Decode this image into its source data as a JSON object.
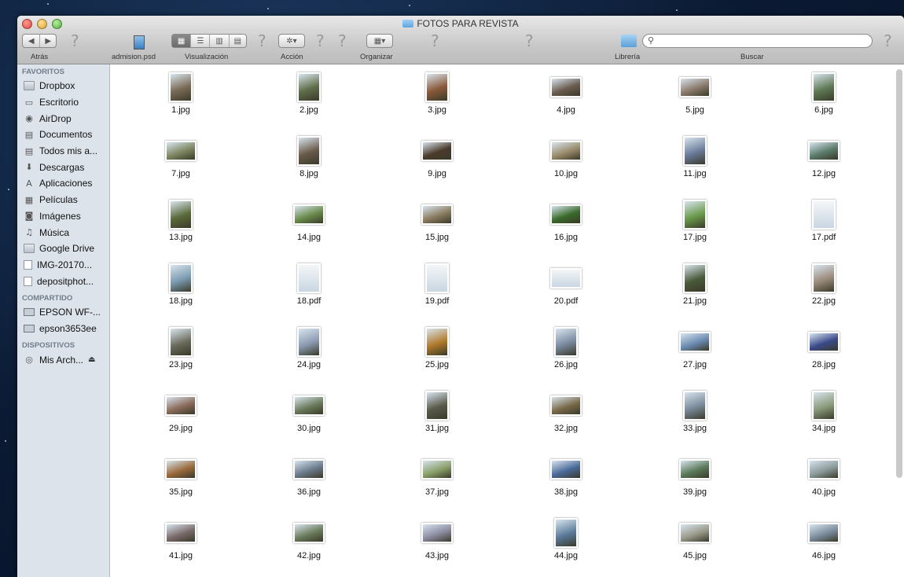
{
  "window": {
    "title": "FOTOS PARA REVISTA"
  },
  "toolbar": {
    "back_label": "Atrás",
    "file_label": "admision.psd",
    "view_label": "Visualización",
    "action_label": "Acción",
    "arrange_label": "Organizar",
    "library_label": "Librería",
    "search_label": "Buscar",
    "search_placeholder": ""
  },
  "sidebar": {
    "favorites_header": "FAVORITOS",
    "favorites": [
      {
        "label": "Dropbox",
        "icon": "folder-icon"
      },
      {
        "label": "Escritorio",
        "icon": "desktop-icon"
      },
      {
        "label": "AirDrop",
        "icon": "airdrop-icon"
      },
      {
        "label": "Documentos",
        "icon": "documents-icon"
      },
      {
        "label": "Todos mis a...",
        "icon": "all-files-icon"
      },
      {
        "label": "Descargas",
        "icon": "downloads-icon"
      },
      {
        "label": "Aplicaciones",
        "icon": "applications-icon"
      },
      {
        "label": "Películas",
        "icon": "movies-icon"
      },
      {
        "label": "Imágenes",
        "icon": "pictures-icon"
      },
      {
        "label": "Música",
        "icon": "music-icon"
      },
      {
        "label": "Google Drive",
        "icon": "folder-icon"
      },
      {
        "label": "IMG-20170...",
        "icon": "document-icon"
      },
      {
        "label": "depositphot...",
        "icon": "document-icon"
      }
    ],
    "shared_header": "COMPARTIDO",
    "shared": [
      {
        "label": "EPSON WF-...",
        "icon": "monitor-icon"
      },
      {
        "label": "epson3653ee",
        "icon": "monitor-icon"
      }
    ],
    "devices_header": "DISPOSITIVOS",
    "devices": [
      {
        "label": "Mis Arch...",
        "icon": "disc-icon"
      }
    ]
  },
  "files": [
    "1.jpg",
    "2.jpg",
    "3.jpg",
    "4.jpg",
    "5.jpg",
    "6.jpg",
    "7.jpg",
    "8.jpg",
    "9.jpg",
    "10.jpg",
    "11.jpg",
    "12.jpg",
    "13.jpg",
    "14.jpg",
    "15.jpg",
    "16.jpg",
    "17.jpg",
    "17.pdf",
    "18.jpg",
    "18.pdf",
    "19.pdf",
    "20.pdf",
    "21.jpg",
    "22.jpg",
    "23.jpg",
    "24.jpg",
    "25.jpg",
    "26.jpg",
    "27.jpg",
    "28.jpg",
    "29.jpg",
    "30.jpg",
    "31.jpg",
    "32.jpg",
    "33.jpg",
    "34.jpg",
    "35.jpg",
    "36.jpg",
    "37.jpg",
    "38.jpg",
    "39.jpg",
    "40.jpg",
    "41.jpg",
    "42.jpg",
    "43.jpg",
    "44.jpg",
    "45.jpg",
    "46.jpg"
  ],
  "thumb_colors": [
    "#7a6a55",
    "#5f6e4a",
    "#8b5a3a",
    "#6b5d4f",
    "#8a7a6a",
    "#5f7a55",
    "#7d8560",
    "#6a5a4a",
    "#4a3a2a",
    "#9a8a6a",
    "#6a7a9a",
    "#5a7a6a",
    "#5a6a3a",
    "#6a8a4a",
    "#8a7a60",
    "#3a6a2a",
    "#6a9a4a",
    "#8ac04a",
    "#7a9ab0",
    "#9abcd6",
    "#8aaac6",
    "#e0c890",
    "#4a5a3a",
    "#9a8a7a",
    "#6a6a5a",
    "#8a9ab0",
    "#b07a2a",
    "#7a8aa0",
    "#6a8ab0",
    "#3a4a8a",
    "#8a6a5a",
    "#6a7a5a",
    "#5a5a4a",
    "#7a6a4a",
    "#7a8a9a",
    "#8a9a7a",
    "#9a6a3a",
    "#6a7a8a",
    "#8aa06a",
    "#4a6a9a",
    "#5a7a5a",
    "#8a9a9a",
    "#7a6a6a",
    "#6a7a5a",
    "#8a8aa0",
    "#5a7a9a",
    "#9a9a8a",
    "#7a8a9a"
  ]
}
